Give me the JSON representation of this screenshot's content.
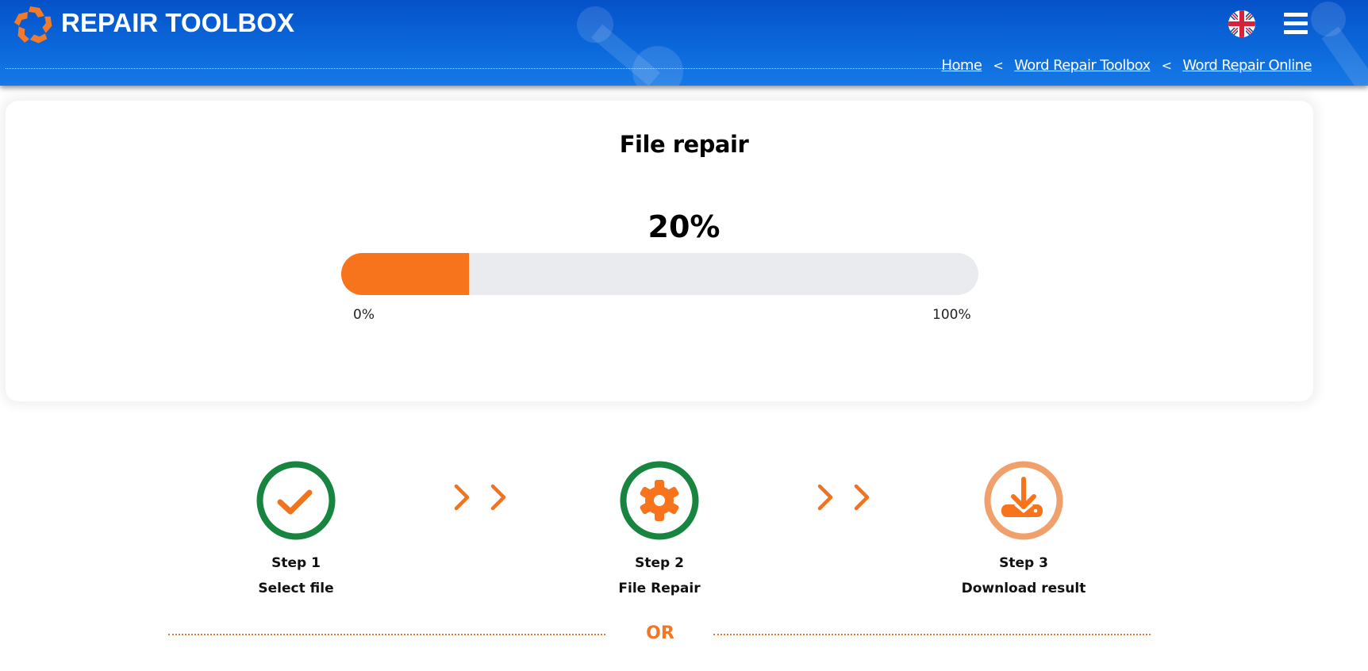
{
  "header": {
    "brand": "REPAIR TOOLBOX",
    "logo_icon": "orange-pinwheel-logo",
    "language_icon": "uk-flag-icon",
    "menu_icon": "hamburger-menu-icon",
    "breadcrumb": [
      {
        "label": "Home"
      },
      {
        "label": "Word Repair Toolbox"
      },
      {
        "label": "Word Repair Online"
      }
    ],
    "breadcrumb_separator": "<"
  },
  "repair": {
    "title": "File repair",
    "progress_percent": 20,
    "progress_label": "20%",
    "min_label": "0%",
    "max_label": "100%"
  },
  "steps": [
    {
      "number": "Step 1",
      "name": "Select file",
      "icon": "checkmark-icon",
      "status": "done"
    },
    {
      "number": "Step 2",
      "name": "File Repair",
      "icon": "gear-icon",
      "status": "active"
    },
    {
      "number": "Step 3",
      "name": "Download result",
      "icon": "download-icon",
      "status": "pending"
    }
  ],
  "divider": {
    "label": "OR"
  },
  "colors": {
    "header_blue": "#0b68da",
    "accent_orange": "#f7731c",
    "step_green": "#17843f",
    "step_pending_ring": "#f0a06a",
    "progress_track": "#e9ebee"
  }
}
